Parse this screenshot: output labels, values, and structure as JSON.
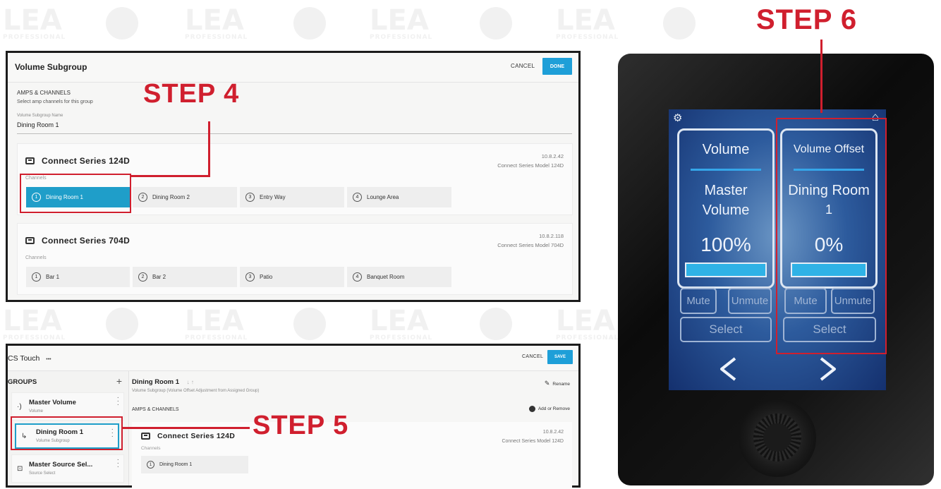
{
  "watermark": {
    "brand": "LEA",
    "tagline": "PROFESSIONAL"
  },
  "steps": {
    "step4": "STEP 4",
    "step5": "STEP 5",
    "step6": "STEP 6"
  },
  "colors": {
    "accent": "#1e9fd8",
    "selected": "#1f9ec9",
    "step_red": "#d01f2e"
  },
  "panel1": {
    "title": "Volume Subgroup",
    "cancel_label": "CANCEL",
    "done_label": "DONE",
    "section_title": "AMPS & CHANNELS",
    "section_hint": "Select amp channels for this group",
    "name_label": "Volume Subgroup Name",
    "name_value": "Dining Room 1",
    "channels_label": "Channels",
    "devices": [
      {
        "name": "Connect Series 124D",
        "ip": "10.8.2.42",
        "model": "Connect Series Model 124D",
        "channels": [
          {
            "num": "1",
            "label": "Dining Room 1",
            "selected": true
          },
          {
            "num": "2",
            "label": "Dining Room 2",
            "selected": false
          },
          {
            "num": "3",
            "label": "Entry Way",
            "selected": false
          },
          {
            "num": "4",
            "label": "Lounge Area",
            "selected": false
          }
        ]
      },
      {
        "name": "Connect Series 704D",
        "ip": "10.8.2.118",
        "model": "Connect Series Model 704D",
        "channels": [
          {
            "num": "1",
            "label": "Bar 1",
            "selected": false
          },
          {
            "num": "2",
            "label": "Bar 2",
            "selected": false
          },
          {
            "num": "3",
            "label": "Patio",
            "selected": false
          },
          {
            "num": "4",
            "label": "Banquet Room",
            "selected": false
          }
        ]
      }
    ]
  },
  "panel2": {
    "title": "CS Touch",
    "more_label": "•••",
    "cancel_label": "CANCEL",
    "save_label": "SAVE",
    "groups_label": "GROUPS",
    "add_label": "+",
    "groups": [
      {
        "icon": "speaker-icon",
        "glyph": "·)",
        "name": "Master Volume",
        "sub": "Volume"
      },
      {
        "icon": "subgroup-arrow-icon",
        "glyph": "↳",
        "name": "Dining Room 1",
        "sub": "Volume Subgroup"
      },
      {
        "icon": "source-select-icon",
        "glyph": "⊡",
        "name": "Master Source Sel...",
        "sub": "Source Select"
      }
    ],
    "detail": {
      "title": "Dining Room 1",
      "sort_icons": "↓ ↑",
      "subtitle": "Volume Subgroup (Volume Offset Adjustment from Assigned Group)",
      "rename_label": "Rename",
      "section_title": "AMPS & CHANNELS",
      "add_remove_label": "Add or Remove",
      "device_name": "Connect Series 124D",
      "device_ip": "10.8.2.42",
      "device_model": "Connect Series Model 124D",
      "channels_label": "Channels",
      "channel": {
        "num": "1",
        "label": "Dining Room 1"
      }
    }
  },
  "touch": {
    "left": {
      "title": "Volume",
      "name_line1": "Master",
      "name_line2": "Volume",
      "level": "100%",
      "level_fraction": 1.0,
      "mute": "Mute",
      "unmute": "Unmute",
      "select": "Select"
    },
    "right": {
      "title": "Volume Offset",
      "name_line1": "Dining Room",
      "name_line2": "1",
      "level": "0%",
      "level_fraction": 1.0,
      "mute": "Mute",
      "unmute": "Unmute",
      "select": "Select"
    },
    "prev_glyph": "<",
    "next_glyph": ">"
  }
}
